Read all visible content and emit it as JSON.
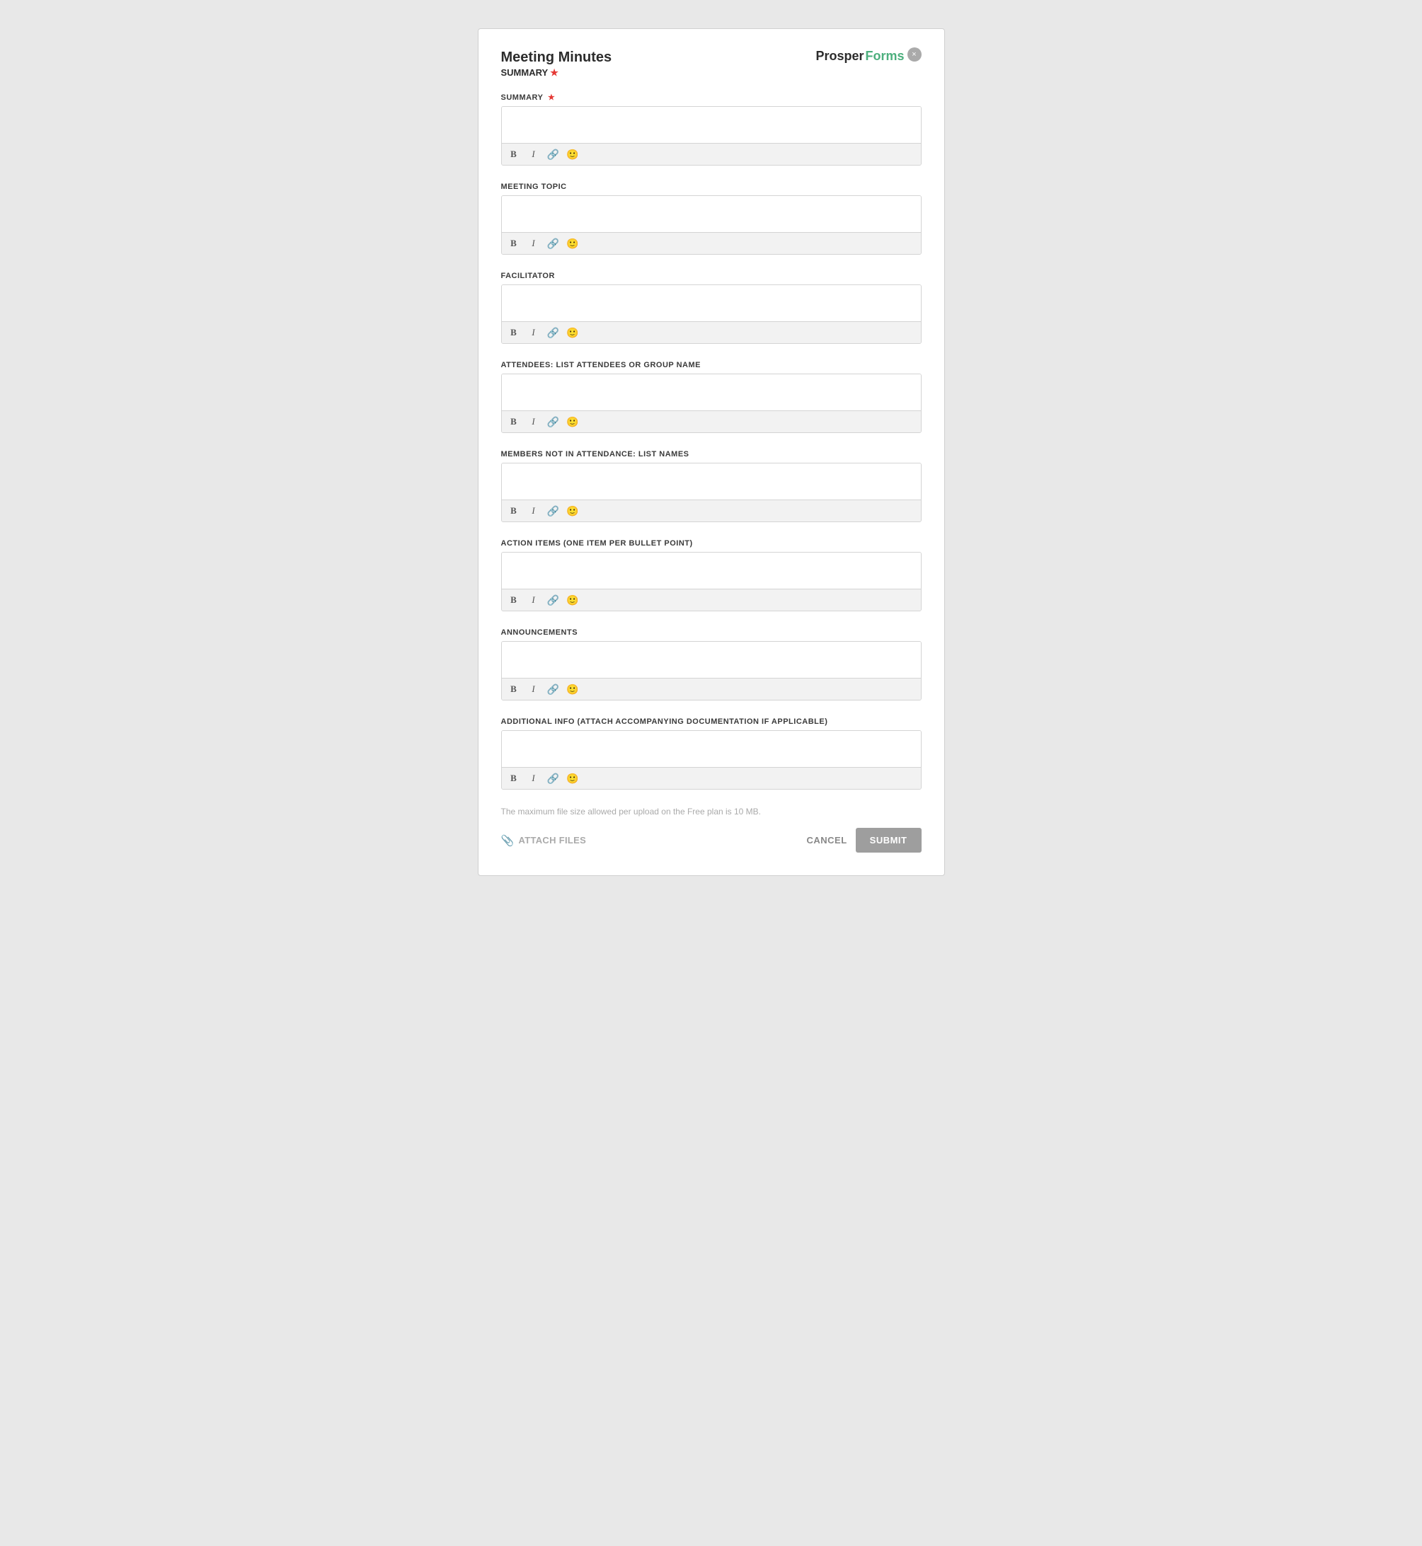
{
  "header": {
    "title": "Meeting Minutes",
    "subtitle": "SUMMARY",
    "required": true,
    "logo": {
      "prosper": "Prosper",
      "forms": "Forms"
    },
    "close_label": "×"
  },
  "fields": [
    {
      "id": "summary",
      "label": "SUMMARY",
      "required": true,
      "placeholder": ""
    },
    {
      "id": "meeting_topic",
      "label": "MEETING TOPIC",
      "required": false,
      "placeholder": ""
    },
    {
      "id": "facilitator",
      "label": "FACILITATOR",
      "required": false,
      "placeholder": ""
    },
    {
      "id": "attendees",
      "label": "ATTENDEES: LIST ATTENDEES OR GROUP NAME",
      "required": false,
      "placeholder": ""
    },
    {
      "id": "members_not_attending",
      "label": "MEMBERS NOT IN ATTENDANCE: LIST NAMES",
      "required": false,
      "placeholder": ""
    },
    {
      "id": "action_items",
      "label": "ACTION ITEMS (ONE ITEM PER BULLET POINT)",
      "required": false,
      "placeholder": ""
    },
    {
      "id": "announcements",
      "label": "ANNOUNCEMENTS",
      "required": false,
      "placeholder": ""
    },
    {
      "id": "additional_info",
      "label": "ADDITIONAL INFO (ATTACH ACCOMPANYING DOCUMENTATION IF APPLICABLE)",
      "required": false,
      "placeholder": ""
    }
  ],
  "toolbar": {
    "bold": "B",
    "italic": "I",
    "link": "🔗",
    "emoji": "🙂"
  },
  "footer": {
    "file_size_note": "The maximum file size allowed per upload on the Free plan is 10 MB.",
    "attach_label": "ATTACH FILES",
    "cancel_label": "CANCEL",
    "submit_label": "SUBMIT"
  }
}
